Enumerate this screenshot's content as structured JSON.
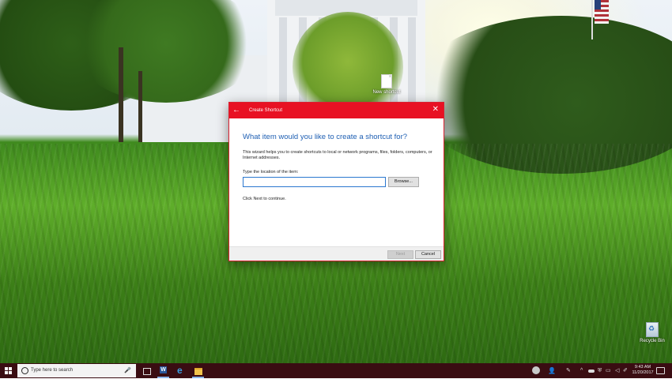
{
  "desktop": {
    "icons": [
      {
        "label": "New shortcut"
      },
      {
        "label": "Recycle Bin"
      }
    ]
  },
  "dialog": {
    "title": "Create Shortcut",
    "heading": "What item would you like to create a shortcut for?",
    "description": "This wizard helps you to create shortcuts to local or network programs, files, folders, computers, or Internet addresses.",
    "location_label": "Type the location of the item:",
    "location_value": "",
    "browse_label": "Browse...",
    "next_hint": "Click Next to continue.",
    "next_label": "Next",
    "cancel_label": "Cancel",
    "accent_color": "#e81123",
    "heading_color": "#1e5fb3"
  },
  "taskbar": {
    "search_placeholder": "Type here to search",
    "pinned": [
      "task-view-icon",
      "word-icon",
      "edge-icon",
      "file-explorer-icon"
    ],
    "clock_time": "9:43 AM",
    "clock_date": "11/20/2017"
  }
}
